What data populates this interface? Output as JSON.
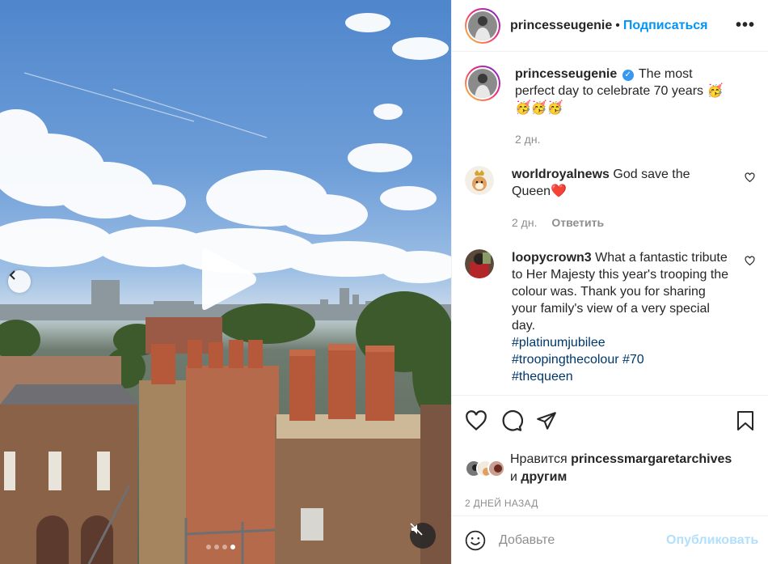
{
  "header": {
    "username": "princesseugenie",
    "separator": "•",
    "follow_label": "Подписаться",
    "more_label": "•••"
  },
  "caption": {
    "username": "princesseugenie",
    "verified": "✓",
    "text": "The most perfect day to celebrate 70 years 🥳",
    "text2": "🥳🥳🥳",
    "time": "2 дн."
  },
  "comments": [
    {
      "username": "worldroyalnews",
      "text": "God save the Queen❤️",
      "time": "2 дн.",
      "reply_label": "Ответить"
    },
    {
      "username": "loopycrown3",
      "text": "What a fantastic tribute to Her Majesty this year's trooping the colour was. Thank you for sharing your family's view of a very special day.",
      "tags": [
        "#platinumjubilee",
        "#troopingthecolour",
        "#70",
        "#thequeen"
      ]
    }
  ],
  "likes": {
    "prefix": "Нравится",
    "user": "princessmargaretarchives",
    "suffix_and": "и",
    "suffix_others": "другим"
  },
  "post_date": "2 ДНЕЙ НАЗАД",
  "add_comment": {
    "placeholder": "Добавьте",
    "post_label": "Опубликовать"
  },
  "carousel": {
    "slide_count": 4,
    "active_index": 3
  },
  "colors": {
    "follow_blue": "#0095f6",
    "hashtag": "#00376b",
    "muted": "#8e8e8e",
    "post_disabled": "#b2dffc"
  }
}
